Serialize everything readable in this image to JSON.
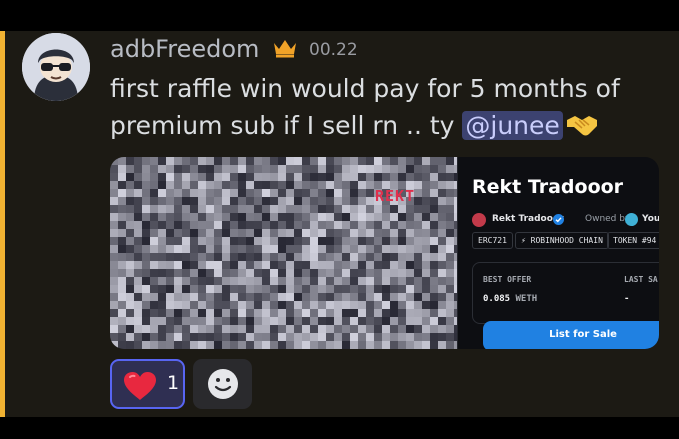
{
  "message": {
    "username": "adbFreedom",
    "timestamp": "00.22",
    "text_line1": "first raffle win would pay for 5 months of",
    "text_line2_before": "premium sub if I sell rn .. ty ",
    "mention": "@junee"
  },
  "embed": {
    "image_tag": "REKT",
    "title": "Rekt Tradooor",
    "creator_name": "Rekt Tradooor",
    "owned_label": "Owned by",
    "owner_name": "You",
    "chips": [
      "ERC721",
      "⚡ ROBINHOOD CHAIN",
      "TOKEN #94"
    ],
    "best_offer_label": "BEST OFFER",
    "best_offer_value": "0.085",
    "best_offer_unit": "WETH",
    "last_sale_label": "LAST SA",
    "last_sale_value": "-",
    "button_label": "List for Sale"
  },
  "reactions": [
    {
      "emoji": "heart-icon",
      "count": "1",
      "selected": true
    }
  ],
  "colors": {
    "accent": "#f0b232",
    "mention_bg": "#3c4270",
    "reaction_border": "#5865f2",
    "button": "#2081e2",
    "chat_bg": "#1c1a14"
  }
}
